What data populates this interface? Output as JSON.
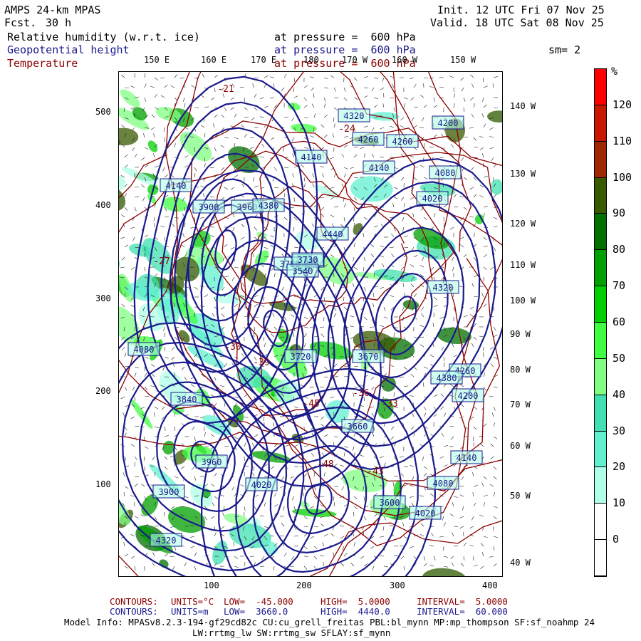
{
  "header": {
    "model": "AMPS 24-km MPAS",
    "fcst_label": "Fcst.",
    "fcst_value": "30 h",
    "init_line": "Init. 12 UTC Fri 07 Nov 25",
    "valid_line": "Valid. 18 UTC Sat 08 Nov 25",
    "fields": [
      {
        "name": "Relative humidity (w.r.t. ice)",
        "level": "at pressure =  600 hPa",
        "color": "#000000"
      },
      {
        "name": "Geopotential height",
        "level": "at pressure =  600 hPa",
        "color": "#1a1a8c"
      },
      {
        "name": "Temperature",
        "level": "at pressure =  600 hPa",
        "color": "#8c0000"
      }
    ],
    "smoothing": "sm= 2"
  },
  "map": {
    "y_ticks": [
      "500",
      "400",
      "300",
      "200",
      "100"
    ],
    "x_ticks": [
      "100",
      "200",
      "300",
      "400"
    ],
    "lon_top": [
      "150 E",
      "160 E",
      "170 E",
      "180",
      "170 W",
      "160 W",
      "150 W"
    ],
    "lon_right": [
      "140 W",
      "130 W",
      "120 W",
      "110 W",
      "100 W",
      "90 W",
      "80 W",
      "70 W",
      "60 W",
      "50 W",
      "40 W"
    ],
    "height_labels": [
      "4320",
      "4260",
      "4260",
      "4200",
      "4140",
      "4140",
      "4080",
      "4020",
      "3960",
      "3900",
      "3840",
      "3780",
      "3730",
      "3720",
      "3670",
      "3660",
      "3600",
      "3540",
      "4020",
      "4080",
      "4140",
      "4200",
      "4260",
      "4320",
      "4380",
      "4140",
      "4080",
      "4020",
      "3960",
      "3900",
      "3840",
      "4440",
      "4380",
      "4320"
    ],
    "temp_labels": [
      "-21",
      "-24",
      "-30",
      "-36",
      "-39",
      "-45",
      "-48",
      "-43",
      "-33",
      "-27"
    ]
  },
  "colorbar": {
    "unit": "%",
    "labels": [
      "120",
      "110",
      "100",
      "90",
      "80",
      "70",
      "60",
      "50",
      "40",
      "30",
      "20",
      "10",
      "0"
    ],
    "colors": [
      "#ff0000",
      "#c81800",
      "#a02800",
      "#3a5a00",
      "#007000",
      "#00a000",
      "#00d000",
      "#40ff40",
      "#80ff80",
      "#40e0b0",
      "#60f0d0",
      "#b0ffe8",
      "#ffffff",
      "#ffffff"
    ]
  },
  "footer": {
    "temp_contours": {
      "label": "CONTOURS:",
      "units": "UNITS=°C",
      "low": "LOW=  -45.000",
      "high": "HIGH=  5.0000",
      "interval": "INTERVAL=  5.0000"
    },
    "height_contours": {
      "label": "CONTOURS:",
      "units": "UNITS=m",
      "low": "LOW=  3660.0",
      "high": "HIGH=  4440.0",
      "interval": "INTERVAL=  60.000"
    },
    "model_info_1": "Model Info: MPASv8.2.3-194-gf29cd82c CU:cu_grell_freitas PBL:bl_mynn MP:mp_thompson SF:sf_noahmp 24",
    "model_info_2": "LW:rrtmg_lw SW:rrtmg_sw SFLAY:sf_mynn"
  }
}
